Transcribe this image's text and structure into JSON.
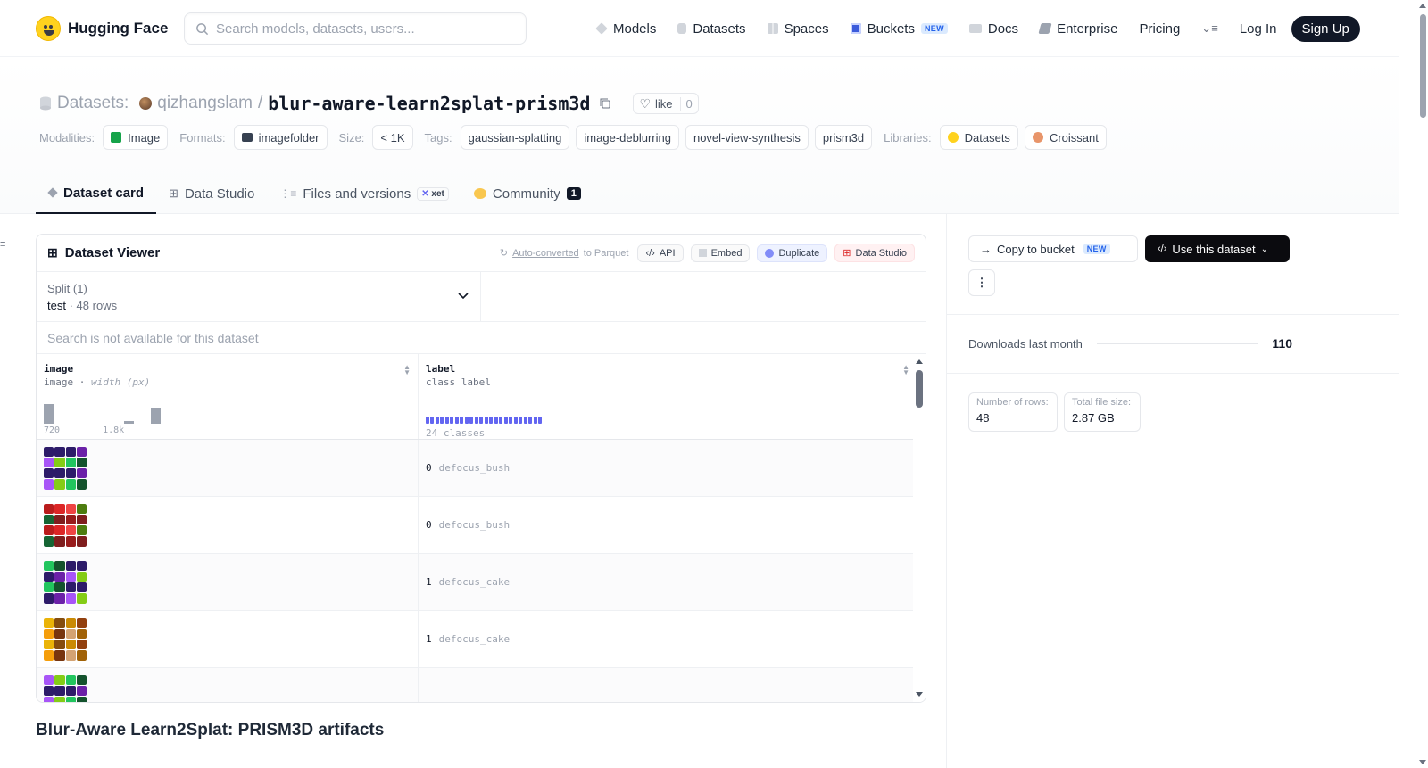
{
  "header": {
    "brand": "Hugging Face",
    "search_placeholder": "Search models, datasets, users...",
    "nav": [
      {
        "label": "Models",
        "icon": "cube-icon"
      },
      {
        "label": "Datasets",
        "icon": "database-icon"
      },
      {
        "label": "Spaces",
        "icon": "grid-icon"
      },
      {
        "label": "Buckets",
        "icon": "bucket-icon",
        "badge": "NEW"
      },
      {
        "label": "Docs",
        "icon": "book-icon"
      },
      {
        "label": "Enterprise",
        "icon": "enterprise-icon"
      },
      {
        "label": "Pricing"
      },
      {
        "label": "Log In"
      },
      {
        "label": "Sign Up"
      }
    ]
  },
  "repo": {
    "kind": "Datasets:",
    "owner": "qizhangslam",
    "separator": "/",
    "name": "blur-aware-learn2splat-prism3d",
    "like_label": "like",
    "like_count": "0"
  },
  "tags": {
    "modalities_label": "Modalities:",
    "modalities": [
      "Image"
    ],
    "formats_label": "Formats:",
    "formats": [
      "imagefolder"
    ],
    "size_label": "Size:",
    "size": "< 1K",
    "tags_label": "Tags:",
    "tags": [
      "gaussian-splatting",
      "image-deblurring",
      "novel-view-synthesis",
      "prism3d"
    ],
    "libraries_label": "Libraries:",
    "libraries": [
      "Datasets",
      "Croissant"
    ]
  },
  "tabs": [
    {
      "label": "Dataset card",
      "active": true
    },
    {
      "label": "Data Studio"
    },
    {
      "label": "Files and versions",
      "badge": "xet"
    },
    {
      "label": "Community",
      "count": "1"
    }
  ],
  "viewer": {
    "title": "Dataset Viewer",
    "auto_converted_link": "Auto-converted",
    "auto_converted_rest": " to Parquet",
    "buttons": [
      "API",
      "Embed",
      "Duplicate",
      "Data Studio"
    ],
    "split_label": "Split (1)",
    "split_value": "test",
    "split_rows": "48 rows",
    "search_msg": "Search is not available for this dataset",
    "columns": [
      {
        "name": "image",
        "type": "image",
        "type_note": "width (px)",
        "hist_min": "720",
        "hist_max": "1.8k"
      },
      {
        "name": "label",
        "type": "class label",
        "classes": "24 classes"
      }
    ],
    "histogram": [
      0.85,
      0,
      0,
      0,
      0,
      0,
      0.1,
      0,
      0.7
    ],
    "rows": [
      {
        "num": "0",
        "label": "defocus_bush",
        "thumb": "purple"
      },
      {
        "num": "0",
        "label": "defocus_bush",
        "thumb": "red"
      },
      {
        "num": "1",
        "label": "defocus_cake",
        "thumb": "purple"
      },
      {
        "num": "1",
        "label": "defocus_cake",
        "thumb": "gold"
      },
      {
        "num": "",
        "label": "",
        "thumb": "purple"
      }
    ]
  },
  "sidebar": {
    "copy_label": "Copy to bucket",
    "copy_badge": "NEW",
    "use_label": "Use this dataset",
    "more_label": "⋮",
    "downloads_label": "Downloads last month",
    "downloads_value": "110",
    "rows_label": "Number of rows:",
    "rows_value": "48",
    "size_label": "Total file size:",
    "size_value": "2.87 GB"
  },
  "readme": {
    "title": "Blur-Aware Learn2Splat: PRISM3D artifacts"
  }
}
